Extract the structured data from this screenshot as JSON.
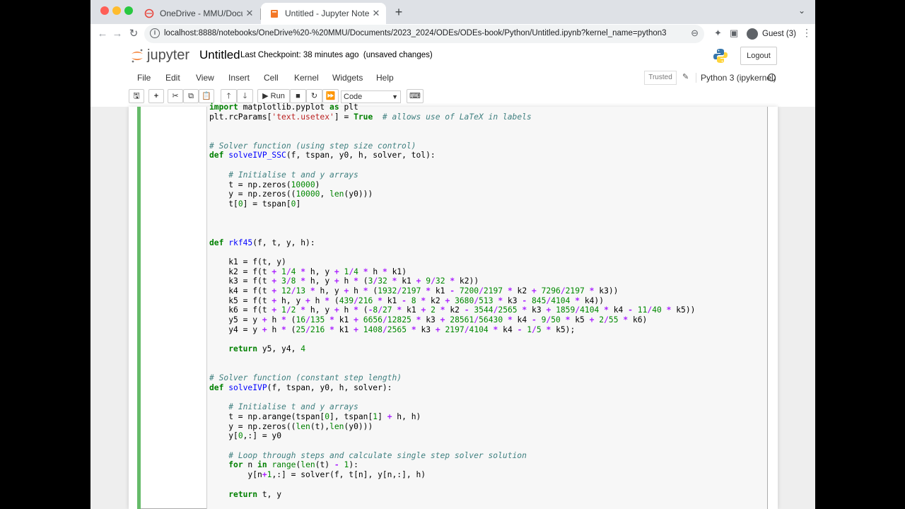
{
  "browser": {
    "tabs": [
      {
        "title": "OneDrive - MMU/Documents/",
        "active": false
      },
      {
        "title": "Untitled - Jupyter Notebook",
        "active": true
      }
    ],
    "url": "localhost:8888/notebooks/OneDrive%20-%20MMU/Documents/2023_2024/ODEs/ODEs-book/Python/Untitled.ipynb?kernel_name=python3",
    "profile": "Guest (3)"
  },
  "jupyter": {
    "logo_text": "jupyter",
    "notebook_title": "Untitled",
    "checkpoint": "Last Checkpoint: 38 minutes ago",
    "save_status": "(unsaved changes)",
    "logout_label": "Logout",
    "menu": [
      "File",
      "Edit",
      "View",
      "Insert",
      "Cell",
      "Kernel",
      "Widgets",
      "Help"
    ],
    "trusted_label": "Trusted",
    "kernel_name": "Python 3 (ipykernel)",
    "toolbar": {
      "run_label": "Run",
      "cell_type": "Code"
    }
  },
  "code_lines": [
    "import matplotlib.pyplot as plt",
    "plt.rcParams['text.usetex'] = True  # allows use of LaTeX in labels",
    "",
    "",
    "# Solver function (using step size control)",
    "def solveIVP_SSC(f, tspan, y0, h, solver, tol):",
    "",
    "    # Initialise t and y arrays",
    "    t = np.zeros(10000)",
    "    y = np.zeros((10000, len(y0)))",
    "    t[0] = tspan[0]",
    "",
    "",
    "",
    "def rkf45(f, t, y, h):",
    "",
    "    k1 = f(t, y)",
    "    k2 = f(t + 1/4 * h, y + 1/4 * h * k1)",
    "    k3 = f(t + 3/8 * h, y + h * (3/32 * k1 + 9/32 * k2))",
    "    k4 = f(t + 12/13 * h, y + h * (1932/2197 * k1 - 7200/2197 * k2 + 7296/2197 * k3))",
    "    k5 = f(t + h, y + h * (439/216 * k1 - 8 * k2 + 3680/513 * k3 - 845/4104 * k4))",
    "    k6 = f(t + 1/2 * h, y + h * (-8/27 * k1 + 2 * k2 - 3544/2565 * k3 + 1859/4104 * k4 - 11/40 * k5))",
    "    y5 = y + h * (16/135 * k1 + 6656/12825 * k3 + 28561/56430 * k4 - 9/50 * k5 + 2/55 * k6)",
    "    y4 = y + h * (25/216 * k1 + 1408/2565 * k3 + 2197/4104 * k4 - 1/5 * k5);",
    "",
    "    return y5, y4, 4",
    "",
    "",
    "# Solver function (constant step length)",
    "def solveIVP(f, tspan, y0, h, solver):",
    "",
    "    # Initialise t and y arrays",
    "    t = np.arange(tspan[0], tspan[1] + h, h)",
    "    y = np.zeros((len(t),len(y0)))",
    "    y[0,:] = y0",
    "",
    "    # Loop through steps and calculate single step solver solution",
    "    for n in range(len(t) - 1):",
    "        y[n+1,:] = solver(f, t[n], y[n,:], h)",
    "",
    "    return t, y"
  ]
}
